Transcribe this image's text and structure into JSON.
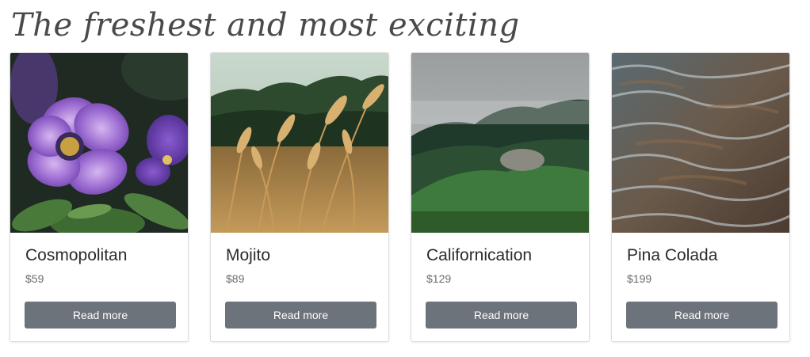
{
  "heading": "The freshest and most exciting",
  "cards": [
    {
      "title": "Cosmopolitan",
      "price": "$59",
      "button": "Read more",
      "image": "purple-flowers-photo"
    },
    {
      "title": "Mojito",
      "price": "$89",
      "button": "Read more",
      "image": "wheat-field-photo"
    },
    {
      "title": "Californication",
      "price": "$129",
      "button": "Read more",
      "image": "misty-forest-hill-photo"
    },
    {
      "title": "Pina Colada",
      "price": "$199",
      "button": "Read more",
      "image": "water-ripples-photo"
    }
  ],
  "colors": {
    "button_bg": "#6c737a",
    "heading_text": "#4a4a4a"
  }
}
